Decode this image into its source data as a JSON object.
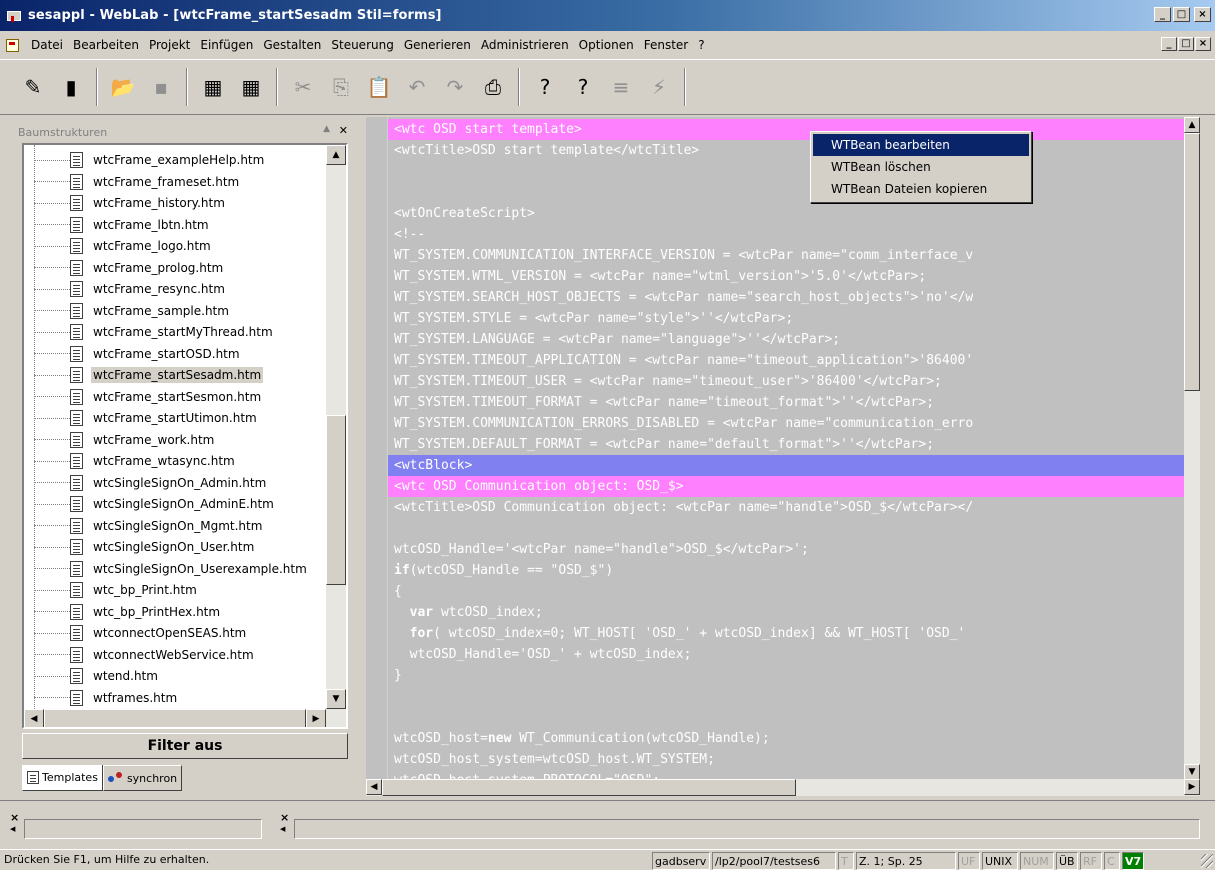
{
  "window": {
    "title": "sesappl - WebLab - [wtcFrame_startSesadm Stil=forms]",
    "buttons": {
      "minimize": "_",
      "maximize": "□",
      "close": "×"
    }
  },
  "menubar": {
    "items": [
      "Datei",
      "Bearbeiten",
      "Projekt",
      "Einfügen",
      "Gestalten",
      "Steuerung",
      "Generieren",
      "Administrieren",
      "Optionen",
      "Fenster",
      "?"
    ]
  },
  "toolbar": {
    "buttons": [
      {
        "name": "connect",
        "glyph": "✎",
        "disabled": false
      },
      {
        "name": "run",
        "glyph": "▮",
        "disabled": false
      },
      {
        "name": "open",
        "glyph": "📂",
        "disabled": true
      },
      {
        "name": "save",
        "glyph": "▪",
        "disabled": true
      },
      {
        "name": "template-a",
        "glyph": "▦",
        "disabled": false
      },
      {
        "name": "template-b",
        "glyph": "▦",
        "disabled": false
      },
      {
        "name": "cut",
        "glyph": "✂",
        "disabled": true
      },
      {
        "name": "copy",
        "glyph": "⎘",
        "disabled": true
      },
      {
        "name": "paste",
        "glyph": "📋",
        "disabled": true
      },
      {
        "name": "undo",
        "glyph": "↶",
        "disabled": true
      },
      {
        "name": "redo",
        "glyph": "↷",
        "disabled": true
      },
      {
        "name": "print",
        "glyph": "⎙",
        "disabled": false
      },
      {
        "name": "help",
        "glyph": "?",
        "disabled": false
      },
      {
        "name": "context-help",
        "glyph": "?",
        "disabled": false
      },
      {
        "name": "generate",
        "glyph": "≡",
        "disabled": true
      },
      {
        "name": "lightning",
        "glyph": "⚡",
        "disabled": true
      }
    ]
  },
  "leftpanel": {
    "header": "Baumstrukturen",
    "files": [
      "wtcFrame_exampleHelp.htm",
      "wtcFrame_frameset.htm",
      "wtcFrame_history.htm",
      "wtcFrame_lbtn.htm",
      "wtcFrame_logo.htm",
      "wtcFrame_prolog.htm",
      "wtcFrame_resync.htm",
      "wtcFrame_sample.htm",
      "wtcFrame_startMyThread.htm",
      "wtcFrame_startOSD.htm",
      "wtcFrame_startSesadm.htm",
      "wtcFrame_startSesmon.htm",
      "wtcFrame_startUtimon.htm",
      "wtcFrame_work.htm",
      "wtcFrame_wtasync.htm",
      "wtcSingleSignOn_Admin.htm",
      "wtcSingleSignOn_AdminE.htm",
      "wtcSingleSignOn_Mgmt.htm",
      "wtcSingleSignOn_User.htm",
      "wtcSingleSignOn_Userexample.htm",
      "wtc_bp_Print.htm",
      "wtc_bp_PrintHex.htm",
      "wtconnectOpenSEAS.htm",
      "wtconnectWebService.htm",
      "wtend.htm",
      "wtframes.htm"
    ],
    "selected_index": 10,
    "filter_button": "Filter aus",
    "tabs": [
      "Templates",
      "synchron"
    ]
  },
  "editor": {
    "lines": [
      {
        "text": "<wtc OSD start template>",
        "hl": "pink"
      },
      {
        "text": "<wtcTitle>OSD start template</wtcTitle>",
        "hl": ""
      },
      {
        "text": "",
        "hl": ""
      },
      {
        "text": "",
        "hl": ""
      },
      {
        "text": "<wtOnCreateScript>",
        "hl": ""
      },
      {
        "text": "<!--",
        "hl": ""
      },
      {
        "text": "WT_SYSTEM.COMMUNICATION_INTERFACE_VERSION = <wtcPar name=\"comm_interface_v",
        "hl": ""
      },
      {
        "text": "WT_SYSTEM.WTML_VERSION = <wtcPar name=\"wtml_version\">'5.0'</wtcPar>;",
        "hl": ""
      },
      {
        "text": "WT_SYSTEM.SEARCH_HOST_OBJECTS = <wtcPar name=\"search_host_objects\">'no'</w",
        "hl": ""
      },
      {
        "text": "WT_SYSTEM.STYLE = <wtcPar name=\"style\">''</wtcPar>;",
        "hl": ""
      },
      {
        "text": "WT_SYSTEM.LANGUAGE = <wtcPar name=\"language\">''</wtcPar>;",
        "hl": ""
      },
      {
        "text": "WT_SYSTEM.TIMEOUT_APPLICATION = <wtcPar name=\"timeout_application\">'86400'",
        "hl": ""
      },
      {
        "text": "WT_SYSTEM.TIMEOUT_USER = <wtcPar name=\"timeout_user\">'86400'</wtcPar>;",
        "hl": ""
      },
      {
        "text": "WT_SYSTEM.TIMEOUT_FORMAT = <wtcPar name=\"timeout_format\">''</wtcPar>;",
        "hl": ""
      },
      {
        "text": "WT_SYSTEM.COMMUNICATION_ERRORS_DISABLED = <wtcPar name=\"communication_erro",
        "hl": ""
      },
      {
        "text": "WT_SYSTEM.DEFAULT_FORMAT = <wtcPar name=\"default_format\">''</wtcPar>;",
        "hl": ""
      },
      {
        "text": "<wtcBlock>",
        "hl": "blue"
      },
      {
        "text": "<wtc OSD Communication object: OSD_$>",
        "hl": "pink"
      },
      {
        "text": "<wtcTitle>OSD Communication object: <wtcPar name=\"handle\">OSD_$</wtcPar></",
        "hl": ""
      },
      {
        "text": "",
        "hl": ""
      },
      {
        "text": "wtcOSD_Handle='<wtcPar name=\"handle\">OSD_$</wtcPar>';",
        "hl": ""
      },
      {
        "text": "if(wtcOSD_Handle == \"OSD_$\")",
        "hl": "",
        "kw": "if"
      },
      {
        "text": "{",
        "hl": ""
      },
      {
        "text": "  var wtcOSD_index;",
        "hl": "",
        "kw": "var"
      },
      {
        "text": "  for( wtcOSD_index=0; WT_HOST[ 'OSD_' + wtcOSD_index] && WT_HOST[ 'OSD_'",
        "hl": "",
        "kw": "for"
      },
      {
        "text": "  wtcOSD_Handle='OSD_' + wtcOSD_index;",
        "hl": ""
      },
      {
        "text": "}",
        "hl": ""
      },
      {
        "text": "",
        "hl": ""
      },
      {
        "text": "",
        "hl": ""
      },
      {
        "text": "wtcOSD_host=new WT_Communication(wtcOSD_Handle);",
        "hl": "",
        "kw": "new"
      },
      {
        "text": "wtcOSD_host_system=wtcOSD_host.WT_SYSTEM;",
        "hl": ""
      },
      {
        "text": "wtcOSD_host_system.PROTOCOL=\"OSD\";",
        "hl": ""
      }
    ]
  },
  "context_menu": {
    "items": [
      "WTBean bearbeiten",
      "WTBean löschen",
      "WTBean Dateien kopieren"
    ],
    "selected_index": 0
  },
  "statusbar": {
    "message": "Drücken Sie F1, um Hilfe zu erhalten.",
    "server": "gadbserv",
    "path": "/lp2/pool7/testses6",
    "t": "T",
    "position": "Z. 1; Sp. 25",
    "uf": "UF",
    "unix": "UNIX",
    "num": "NUM",
    "ub": "ÜB",
    "rf": "RF",
    "c": "C",
    "v7": "V7"
  }
}
